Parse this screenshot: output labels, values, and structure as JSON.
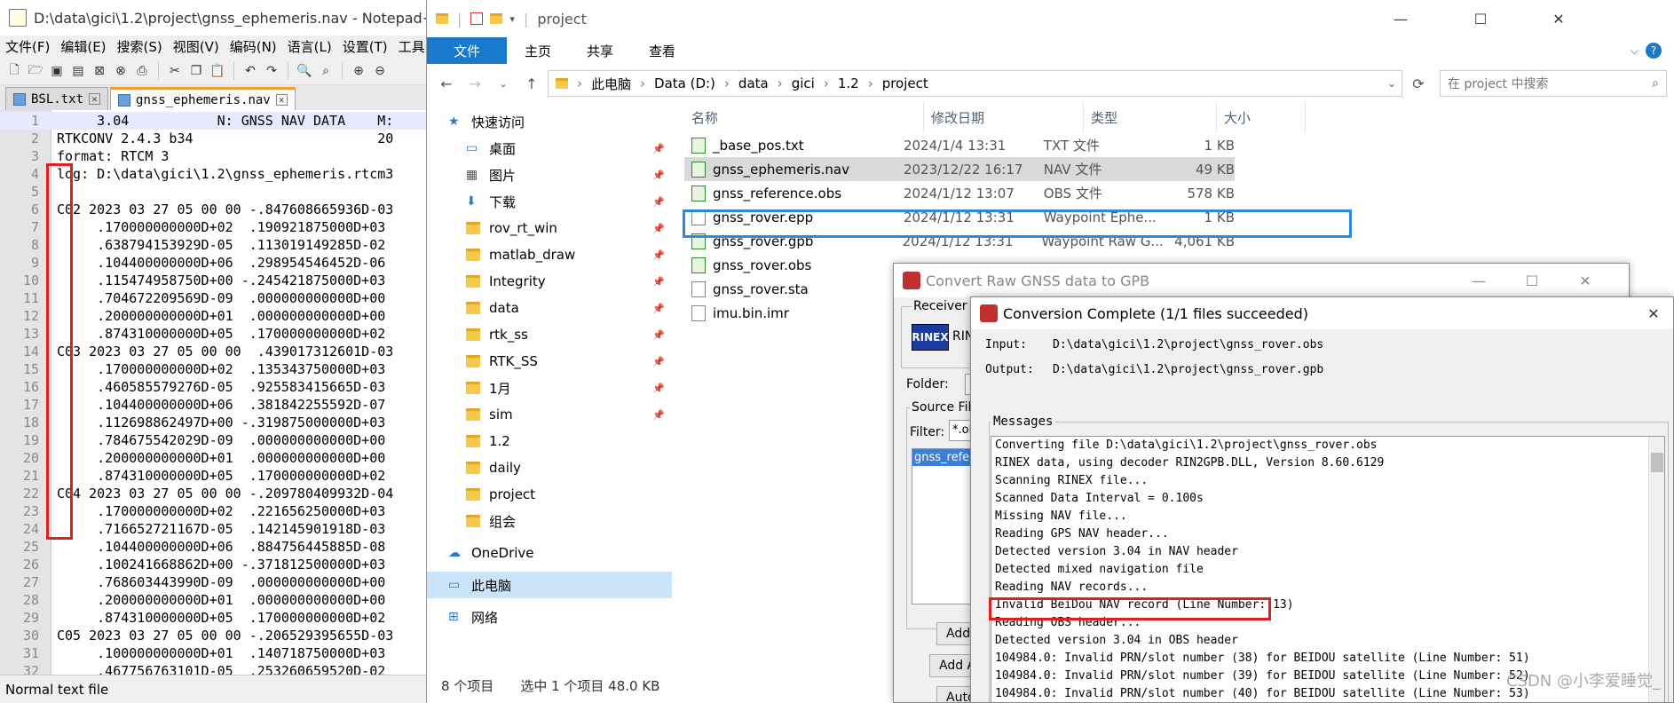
{
  "notepad": {
    "title": "D:\\data\\gici\\1.2\\project\\gnss_ephemeris.nav - Notepad++",
    "menu": [
      "文件(F)",
      "编辑(E)",
      "搜索(S)",
      "视图(V)",
      "编码(N)",
      "语言(L)",
      "设置(T)",
      "工具"
    ],
    "tabs": [
      {
        "label": "BSL.txt"
      },
      {
        "label": "gnss_ephemeris.nav"
      }
    ],
    "lines": [
      {
        "n": "1",
        "t": "     3.04           N: GNSS NAV DATA    M:"
      },
      {
        "n": "2",
        "t": "RTKCONV 2.4.3 b34                       20"
      },
      {
        "n": "3",
        "t": "format: RTCM 3"
      },
      {
        "n": "4",
        "t": "log: D:\\data\\gici\\1.2\\gnss_ephemeris.rtcm3"
      },
      {
        "n": "5",
        "t": ""
      },
      {
        "n": "6",
        "t": "C02 2023 03 27 05 00 00 -.847608665936D-03"
      },
      {
        "n": "7",
        "t": "     .170000000000D+02  .190921875000D+03"
      },
      {
        "n": "8",
        "t": "     .638794153929D-05  .113019149285D-02"
      },
      {
        "n": "9",
        "t": "     .104400000000D+06  .298954546452D-06"
      },
      {
        "n": "10",
        "t": "     .115474958750D+00 -.245421875000D+03"
      },
      {
        "n": "11",
        "t": "     .704672209569D-09  .000000000000D+00"
      },
      {
        "n": "12",
        "t": "     .200000000000D+01  .000000000000D+00"
      },
      {
        "n": "13",
        "t": "     .874310000000D+05  .170000000000D+02"
      },
      {
        "n": "14",
        "t": "C03 2023 03 27 05 00 00  .439017312601D-03"
      },
      {
        "n": "15",
        "t": "     .170000000000D+02  .135343750000D+03"
      },
      {
        "n": "16",
        "t": "     .460585579276D-05  .925583415665D-03"
      },
      {
        "n": "17",
        "t": "     .104400000000D+06  .381842255592D-07"
      },
      {
        "n": "18",
        "t": "     .112698862497D+00 -.319875000000D+03"
      },
      {
        "n": "19",
        "t": "     .784675542029D-09  .000000000000D+00"
      },
      {
        "n": "20",
        "t": "     .200000000000D+01  .000000000000D+00"
      },
      {
        "n": "21",
        "t": "     .874310000000D+05  .170000000000D+02"
      },
      {
        "n": "22",
        "t": "C04 2023 03 27 05 00 00 -.209780409932D-04"
      },
      {
        "n": "23",
        "t": "     .170000000000D+02  .221656250000D+03"
      },
      {
        "n": "24",
        "t": "     .716652721167D-05  .142145901918D-03"
      },
      {
        "n": "25",
        "t": "     .104400000000D+06  .884756445885D-08"
      },
      {
        "n": "26",
        "t": "     .100241668862D+00 -.371812500000D+03"
      },
      {
        "n": "27",
        "t": "     .768603443990D-09  .000000000000D+00"
      },
      {
        "n": "28",
        "t": "     .200000000000D+01  .000000000000D+00"
      },
      {
        "n": "29",
        "t": "     .874310000000D+05  .170000000000D+02"
      },
      {
        "n": "30",
        "t": "C05 2023 03 27 05 00 00 -.206529395655D-03"
      },
      {
        "n": "31",
        "t": "     .100000000000D+01  .140718750000D+03"
      },
      {
        "n": "32",
        "t": "     .467756763101D-05  .253260659520D-02"
      }
    ],
    "status": "Normal text file"
  },
  "explorer": {
    "title": "project",
    "ribbon": [
      "文件",
      "主页",
      "共享",
      "查看"
    ],
    "path": [
      "此电脑",
      "Data (D:)",
      "data",
      "gici",
      "1.2",
      "project"
    ],
    "search_placeholder": "在 project 中搜索",
    "nav": [
      {
        "label": "快速访问",
        "icon": "star-icon",
        "pin": false
      },
      {
        "label": "桌面",
        "icon": "desktop-icon",
        "pin": true
      },
      {
        "label": "图片",
        "icon": "pictures-icon",
        "pin": true
      },
      {
        "label": "下载",
        "icon": "download-icon",
        "pin": true
      },
      {
        "label": "rov_rt_win",
        "icon": "folder-icon",
        "pin": true
      },
      {
        "label": "matlab_draw",
        "icon": "folder-icon",
        "pin": true
      },
      {
        "label": "Integrity",
        "icon": "folder-icon",
        "pin": true
      },
      {
        "label": "data",
        "icon": "folder-icon",
        "pin": true
      },
      {
        "label": "rtk_ss",
        "icon": "folder-icon",
        "pin": true
      },
      {
        "label": "RTK_SS",
        "icon": "folder-icon",
        "pin": true
      },
      {
        "label": "1月",
        "icon": "folder-icon",
        "pin": true
      },
      {
        "label": "sim",
        "icon": "folder-icon",
        "pin": true
      },
      {
        "label": "1.2",
        "icon": "folder-icon",
        "pin": false
      },
      {
        "label": "daily",
        "icon": "folder-icon",
        "pin": false
      },
      {
        "label": "project",
        "icon": "folder-icon",
        "pin": false
      },
      {
        "label": "组会",
        "icon": "folder-icon",
        "pin": false
      },
      {
        "label": "OneDrive",
        "icon": "cloud-icon",
        "pin": false
      },
      {
        "label": "此电脑",
        "icon": "pc-icon",
        "pin": false
      },
      {
        "label": "网络",
        "icon": "network-icon",
        "pin": false
      }
    ],
    "columns": [
      "名称",
      "修改日期",
      "类型",
      "大小"
    ],
    "files": [
      {
        "name": "_base_pos.txt",
        "date": "2024/1/4 13:31",
        "type": "TXT 文件",
        "size": "1 KB"
      },
      {
        "name": "gnss_ephemeris.nav",
        "date": "2023/12/22 16:17",
        "type": "NAV 文件",
        "size": "49 KB"
      },
      {
        "name": "gnss_reference.obs",
        "date": "2024/1/12 13:07",
        "type": "OBS 文件",
        "size": "578 KB"
      },
      {
        "name": "gnss_rover.epp",
        "date": "2024/1/12 13:31",
        "type": "Waypoint Ephe...",
        "size": "1 KB"
      },
      {
        "name": "gnss_rover.gpb",
        "date": "2024/1/12 13:31",
        "type": "Waypoint Raw G...",
        "size": "4,061 KB"
      },
      {
        "name": "gnss_rover.obs",
        "date": "",
        "type": "",
        "size": ""
      },
      {
        "name": "gnss_rover.sta",
        "date": "",
        "type": "",
        "size": ""
      },
      {
        "name": "imu.bin.imr",
        "date": "",
        "type": "",
        "size": ""
      }
    ],
    "status_count": "8 个项目",
    "status_selected": "选中 1 个项目  48.0 KB"
  },
  "convert": {
    "title": "Convert Raw GNSS data to GPB",
    "receiver": "Receiver T",
    "rinex": "RINEX",
    "rinex_short": "RIN",
    "folder": "Folder:",
    "source": "Source File",
    "filter": "Filter:",
    "filter_value": "*.ob",
    "file_item": "gnss_refere",
    "add1": "Add",
    "add2": "Add A",
    "auto": "Auto"
  },
  "complete": {
    "title": "Conversion Complete (1/1 files succeeded)",
    "input_label": "Input:",
    "input_value": "D:\\data\\gici\\1.2\\project\\gnss_rover.obs",
    "output_label": "Output:",
    "output_value": "D:\\data\\gici\\1.2\\project\\gnss_rover.gpb",
    "messages_label": "Messages",
    "messages": [
      "Converting file D:\\data\\gici\\1.2\\project\\gnss_rover.obs",
      "RINEX data, using decoder RIN2GPB.DLL, Version 8.60.6129",
      "Scanning RINEX file...",
      "Scanned Data Interval = 0.100s",
      "Missing NAV file...",
      "Reading GPS NAV header...",
      "Detected version 3.04 in NAV header",
      "Detected mixed navigation file",
      "Reading NAV records...",
      "Invalid BeiDou NAV record (Line Number: 13)",
      "Reading OBS header...",
      "Detected version 3.04 in OBS header",
      "104984.0: Invalid PRN/slot number (38) for BEIDOU satellite (Line Number: 51)",
      "104984.0: Invalid PRN/slot number (39) for BEIDOU satellite (Line Number: 52)",
      "104984.0: Invalid PRN/slot number (40) for BEIDOU satellite (Line Number: 53)"
    ]
  },
  "watermark": "CSDN @小李爱睡觉_"
}
